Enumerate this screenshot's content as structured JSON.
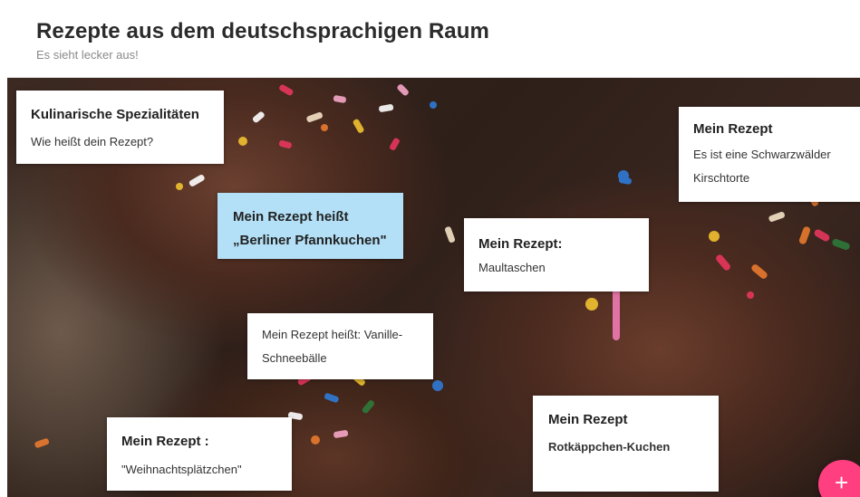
{
  "header": {
    "title": "Rezepte aus dem deutschsprachigen Raum",
    "subtitle": "Es sieht lecker aus!"
  },
  "posts": [
    {
      "heading": "Kulinarische Spezialitäten",
      "body": "Wie heißt dein Rezept?"
    },
    {
      "heading": "Mein Rezept",
      "body": "Es ist eine Schwarzwälder Kirschtorte"
    },
    {
      "heading": "Mein Rezept heißt „Berliner Pfannkuchen\"",
      "body": ""
    },
    {
      "heading": "Mein Rezept:",
      "body": "Maultaschen"
    },
    {
      "heading": "",
      "body": "Mein Rezept heißt: Vanille-Schneebälle"
    },
    {
      "heading": "Mein Rezept",
      "body": "Rotkäppchen-Kuchen"
    },
    {
      "heading": "Mein Rezept :",
      "body": "\"Weihnachtsplätzchen\""
    }
  ],
  "colors": {
    "highlight_post": "#b3e0f7",
    "fab": "#ff3f80"
  },
  "icons": {
    "fab": "plus-icon"
  }
}
